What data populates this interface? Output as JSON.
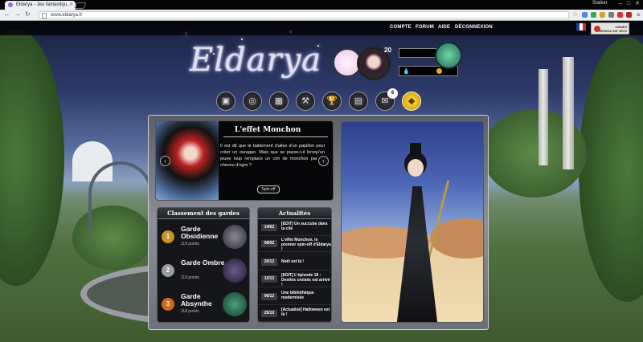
{
  "browser": {
    "tab_title": "Eldarya - Jeu fantastiqu...",
    "url": "www.eldarya.fr",
    "user": "Stalker"
  },
  "site_nav": {
    "links": [
      "COMPTE",
      "FORUM",
      "AIDE",
      "DÉCONNEXION"
    ],
    "partner_label": "RESEAU DE JEUX",
    "partner_logo": "GAMES"
  },
  "header": {
    "logo_text": "Eldarya",
    "level": "20",
    "notification_count": "6"
  },
  "icons": [
    "wardrobe-icon",
    "coins-icon",
    "market-icon",
    "hammer-icon",
    "trophy-icon",
    "map-icon",
    "mail-icon",
    "gold-gem-icon"
  ],
  "featured": {
    "title": "L'effet Monchon",
    "text": "Il est dit que le battement d'ailes d'un papillon peut créer un ouragan. Mais que se passe-t-il lorsqu'un jeune loup remplace un crin de monchon par un cheveu d'ogre ?",
    "button": "Spin-off"
  },
  "guards": {
    "title": "Classement des gardes",
    "items": [
      {
        "rank": "1",
        "name": "Garde Obsidienne",
        "points": "119 points",
        "color": "#c9932b"
      },
      {
        "rank": "2",
        "name": "Garde Ombre",
        "points": "119 points",
        "color": "#9a9aa2"
      },
      {
        "rank": "3",
        "name": "Garde Absynthe",
        "points": "118 points",
        "color": "#d06a1a"
      }
    ]
  },
  "news": {
    "title": "Actualités",
    "items": [
      {
        "date": "14/02",
        "text": "[EDIT] Un succube dans la cité"
      },
      {
        "date": "08/02",
        "text": "L'effet Monchon, le premier spin-off d'Eldarya !"
      },
      {
        "date": "20/12",
        "text": "Noël est là !"
      },
      {
        "date": "12/12",
        "text": "[EDIT] L'épisode 18 : Destins croisés est arrivé !"
      },
      {
        "date": "06/12",
        "text": "Une bibliothèque modernisée"
      },
      {
        "date": "25/10",
        "text": "[Actualisé] Halloween est là !"
      }
    ]
  }
}
